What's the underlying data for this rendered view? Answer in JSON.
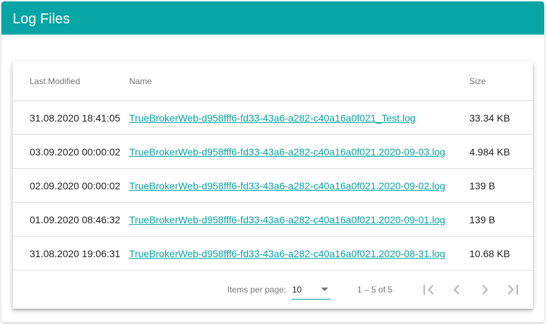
{
  "header": {
    "title": "Log Files"
  },
  "table": {
    "columns": [
      "Last Modified",
      "Name",
      "Size"
    ],
    "rows": [
      {
        "modified": "31.08.2020 18:41:05",
        "name": "TrueBrokerWeb-d958fff6-fd33-43a6-a282-c40a16a0f021_Test.log",
        "size": "33.34 KB"
      },
      {
        "modified": "03.09.2020 00:00:02",
        "name": "TrueBrokerWeb-d958fff6-fd33-43a6-a282-c40a16a0f021.2020-09-03.log",
        "size": "4.984 KB"
      },
      {
        "modified": "02.09.2020 00:00:02",
        "name": "TrueBrokerWeb-d958fff6-fd33-43a6-a282-c40a16a0f021.2020-09-02.log",
        "size": "139 B"
      },
      {
        "modified": "01.09.2020 08:46:32",
        "name": "TrueBrokerWeb-d958fff6-fd33-43a6-a282-c40a16a0f021.2020-09-01.log",
        "size": "139 B"
      },
      {
        "modified": "31.08.2020 19:06:31",
        "name": "TrueBrokerWeb-d958fff6-fd33-43a6-a282-c40a16a0f021.2020-08-31.log",
        "size": "10.68 KB"
      }
    ]
  },
  "paginator": {
    "items_per_page_label": "Items per page:",
    "page_size": "10",
    "range_label": "1 – 5 of 5",
    "buttons": {
      "first": "first-page-icon",
      "prev": "chevron-left-icon",
      "next": "chevron-right-icon",
      "last": "last-page-icon"
    }
  },
  "colors": {
    "accent": "#07a5a5",
    "disabled_icon": "#bdbdbd"
  }
}
